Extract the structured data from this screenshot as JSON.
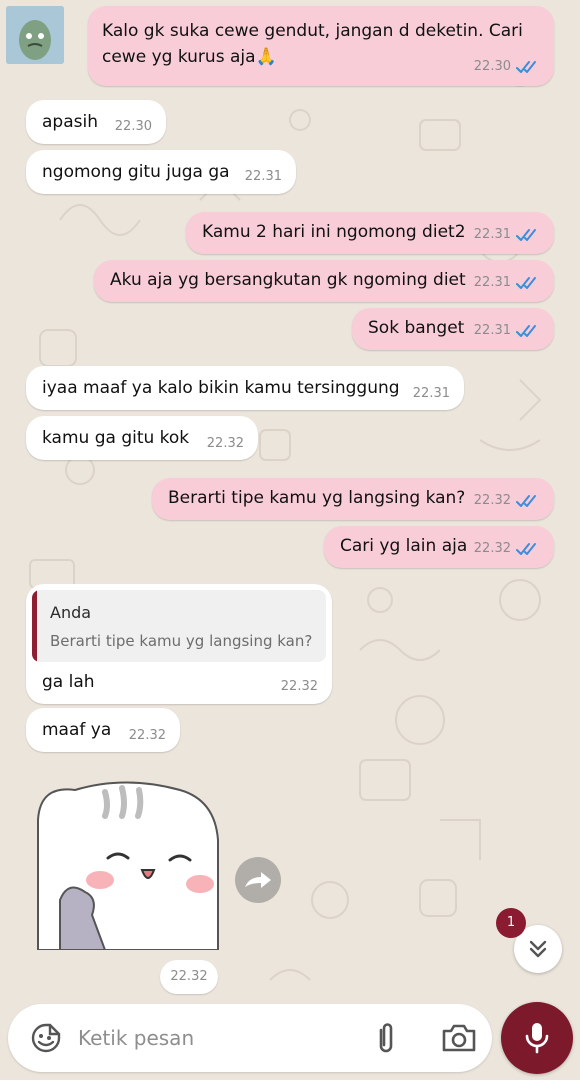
{
  "chat": {
    "contact_avatar": "avatar-sticker",
    "messages": [
      {
        "dir": "out",
        "text": "Kalo gk suka cewe gendut, jangan d deketin. Cari cewe yg kurus aja🙏",
        "time": "22.30",
        "ticks": "double-blue"
      },
      {
        "dir": "in",
        "text": "apasih",
        "time": "22.30"
      },
      {
        "dir": "in",
        "text": "ngomong gitu juga ga",
        "time": "22.31"
      },
      {
        "dir": "out",
        "text": "Kamu 2 hari ini ngomong diet2",
        "time": "22.31",
        "ticks": "double-blue"
      },
      {
        "dir": "out",
        "text": "Aku aja yg bersangkutan gk ngoming diet",
        "time": "22.31",
        "ticks": "double-blue"
      },
      {
        "dir": "out",
        "text": "Sok banget",
        "time": "22.31",
        "ticks": "double-blue"
      },
      {
        "dir": "in",
        "text": "iyaa maaf ya kalo bikin kamu tersinggung",
        "time": "22.31"
      },
      {
        "dir": "in",
        "text": "kamu ga gitu kok",
        "time": "22.32"
      },
      {
        "dir": "out",
        "text": "Berarti tipe kamu yg langsing kan?",
        "time": "22.32",
        "ticks": "double-blue"
      },
      {
        "dir": "out",
        "text": "Cari yg lain aja",
        "time": "22.32",
        "ticks": "double-blue"
      },
      {
        "dir": "in",
        "text": "ga lah",
        "time": "22.32",
        "reply_to": {
          "author": "Anda",
          "text": "Berarti tipe kamu yg langsing kan?"
        }
      },
      {
        "dir": "in",
        "text": "maaf ya",
        "time": "22.32"
      }
    ],
    "sticker": {
      "icon": "cat-sticker",
      "time": "22.32"
    },
    "unread_count": "1"
  },
  "composer": {
    "placeholder": "Ketik pesan",
    "icons": [
      "emoji-icon",
      "attach-icon",
      "camera-icon",
      "mic-icon"
    ]
  },
  "colors": {
    "outgoing_bubble": "#f8cdd8",
    "incoming_bubble": "#ffffff",
    "accent": "#7c1a2c",
    "read_ticks": "#3b8de0",
    "background": "#ece5dc"
  }
}
